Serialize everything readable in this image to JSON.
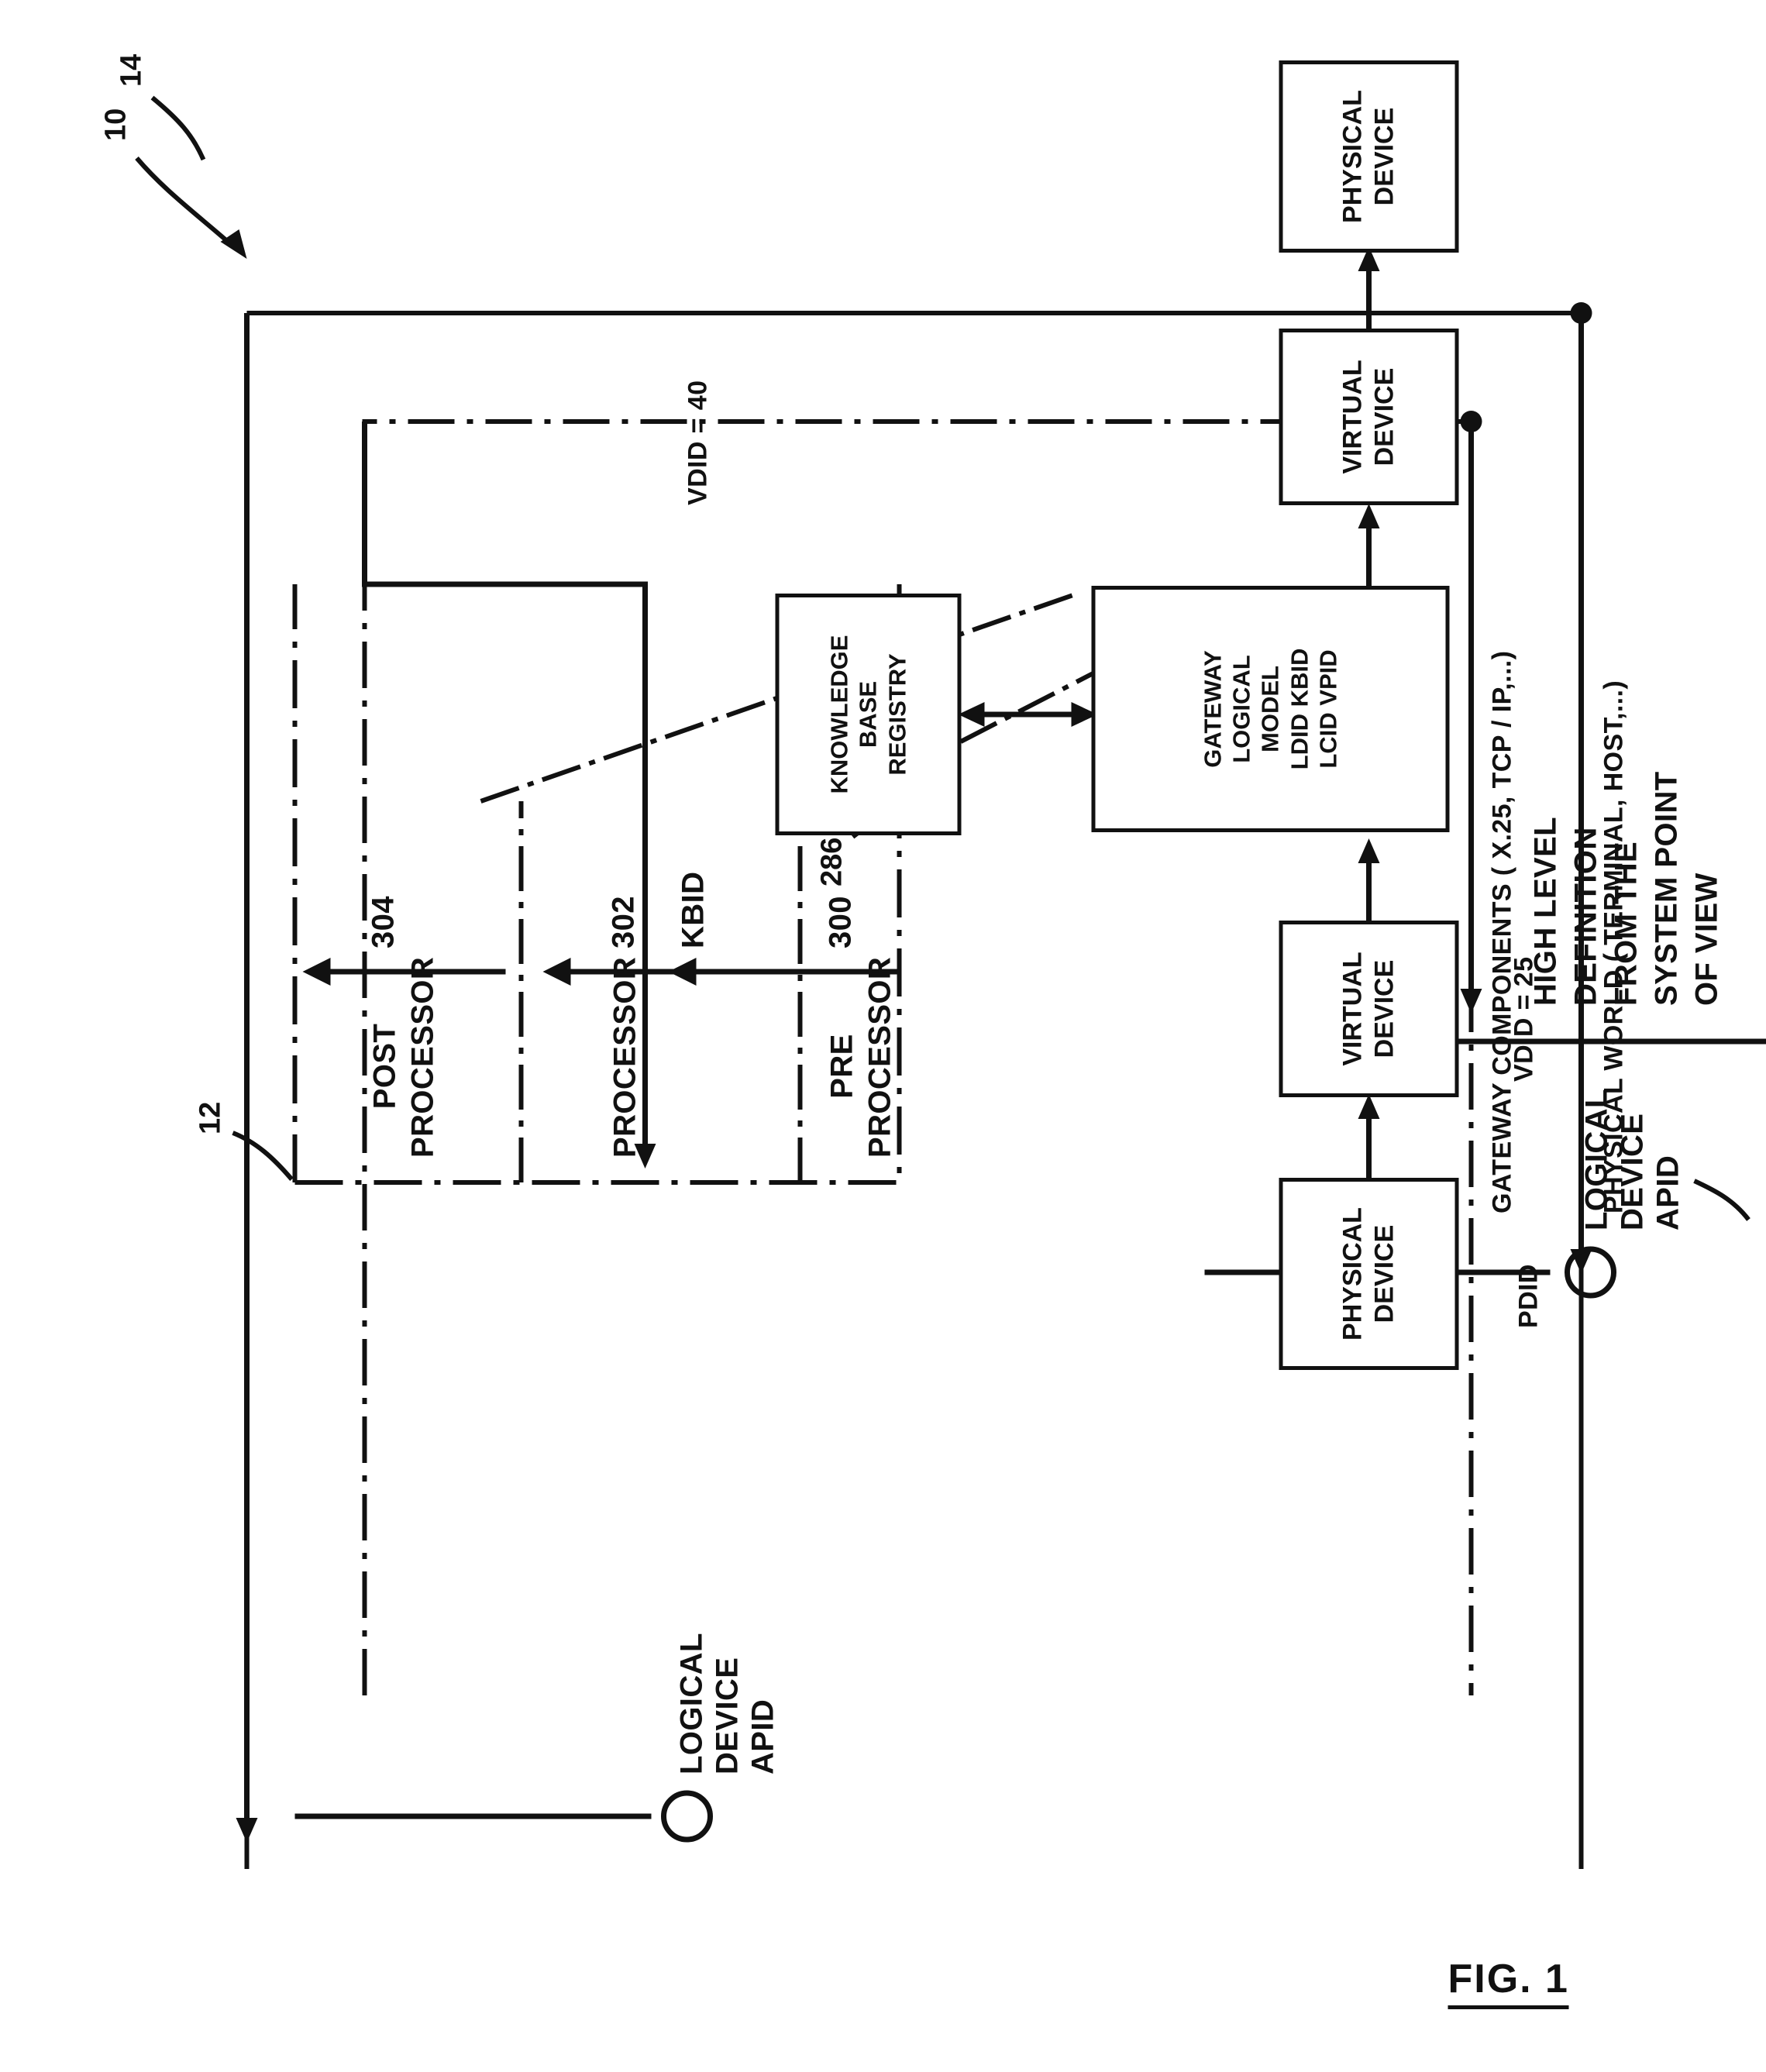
{
  "figure": {
    "label": "FIG. 1",
    "reference_numerals": {
      "system": "10",
      "gateway_boundary": "12",
      "physical_device_in": "14",
      "physical_device_out": "14",
      "pre_processor": "300",
      "processor": "302",
      "post_processor": "304",
      "knowledge_base_registry": "286"
    }
  },
  "boxes": {
    "physical_device_in": "PHYSICAL\nDEVICE",
    "virtual_device_in": "VIRTUAL\nDEVICE",
    "gateway_logical_model": "GATEWAY\nLOGICAL\nMODEL\nLDID KBID\nLCID VPID",
    "virtual_device_out": "VIRTUAL\nDEVICE",
    "physical_device_out": "PHYSICAL\nDEVICE",
    "knowledge_base_registry": "KNOWLEDGE\nBASE\nREGISTRY"
  },
  "identifiers": {
    "pdid": "PDID",
    "vdid_in": "VDID = 25",
    "vdid_out": "VDID = 40",
    "kbid": "KBID"
  },
  "stages": {
    "pre_processor": "PRE\nPROCESSOR",
    "pre_processor_num": "300",
    "processor": "PROCESSOR",
    "processor_num": "302",
    "processor_id": "KBID",
    "post_processor": "POST\nPROCESSOR",
    "post_processor_num": "304"
  },
  "logical_device_left": {
    "line1": "LOGICAL",
    "line2": "DEVICE",
    "line3": "APID",
    "marker": "circle"
  },
  "logical_device_right": {
    "line1": "LOGICAL",
    "line2": "DEVICE",
    "line3": "APID",
    "marker": "circle"
  },
  "annotations": {
    "high_level_definition": "HIGH LEVEL\nDEFINITION\nFROM THE\nSYSTEM POINT\nOF VIEW",
    "gateway_components": "GATEWAY COMPONENTS ( X.25, TCP / IP,...)",
    "physical_world": "PHYSICAL WORLD ( TERMINAL, HOST,...)"
  },
  "colors": {
    "ink": "#111111",
    "paper": "#ffffff"
  }
}
